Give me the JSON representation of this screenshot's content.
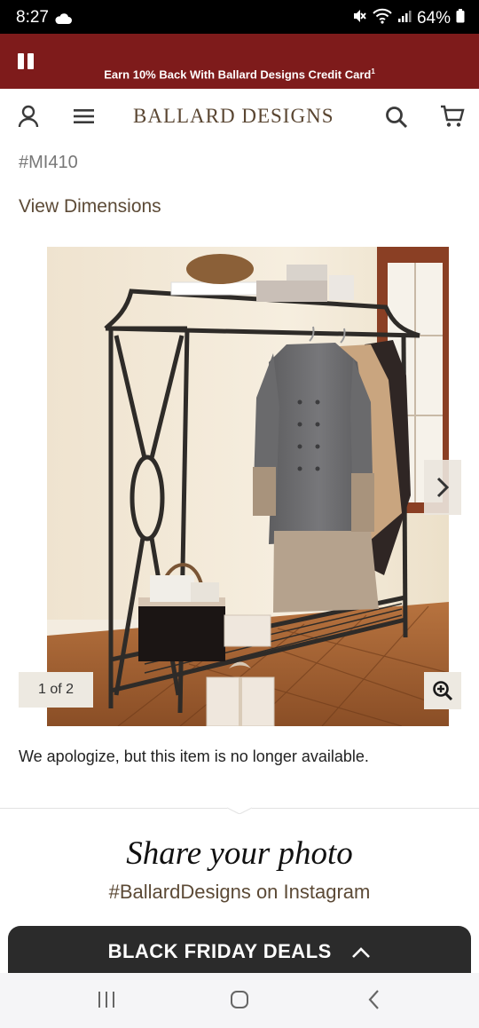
{
  "status_bar": {
    "time": "8:27",
    "battery": "64%",
    "icons": [
      "cloud-icon",
      "mute-icon",
      "wifi-icon",
      "signal-icon",
      "battery-icon"
    ]
  },
  "promo": {
    "text": "Earn 10% Back With Ballard Designs Credit Card",
    "superscript": "1",
    "background": "#7e1b1b",
    "icon": "pause-icon"
  },
  "header": {
    "logo": "BALLARD DESIGNS",
    "icons": [
      "account-icon",
      "menu-icon",
      "search-icon",
      "cart-icon"
    ]
  },
  "product": {
    "sku": "#MI410",
    "view_dimensions": "View Dimensions",
    "image_counter": "1 of 2",
    "unavailable_message": "We apologize, but this item is no longer available.",
    "image_subject": "metal garment rack with coats"
  },
  "share": {
    "title": "Share your photo",
    "subtitle": "#BallardDesigns on Instagram"
  },
  "deals_bar": {
    "label": "BLACK FRIDAY DEALS",
    "icon": "chevron-up-icon"
  },
  "nav_bar": {
    "icons": [
      "recent-apps-icon",
      "home-icon",
      "back-icon"
    ]
  },
  "colors": {
    "brand": "#7e1b1b",
    "accent_text": "#5c4a36",
    "deals_bg": "#2b2b2b"
  }
}
